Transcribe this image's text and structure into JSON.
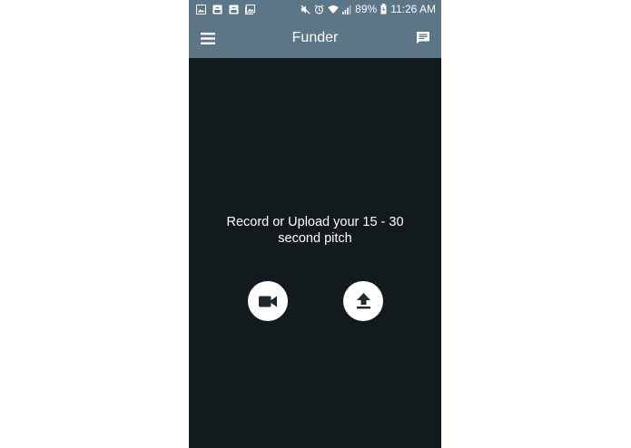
{
  "status_bar": {
    "notification_icons": [
      "image-icon",
      "android-save-icon",
      "android-save-icon",
      "gallery-icon"
    ],
    "system_icons": [
      "mute-icon",
      "alarm-icon",
      "wifi-icon",
      "signal-icon"
    ],
    "battery_percent": "89%",
    "time": "11:26 AM"
  },
  "app_bar": {
    "title": "Funder",
    "menu_icon": "hamburger-menu-icon",
    "chat_icon": "chat-icon"
  },
  "main": {
    "prompt_line1": "Record or Upload your 15 - 30",
    "prompt_line2": "second pitch",
    "record_icon": "videocam-icon",
    "upload_icon": "upload-icon"
  },
  "colors": {
    "toolbar": "#5b7687",
    "background": "#121a1e",
    "button": "#ffffff",
    "icon_dark": "#1e2a30"
  }
}
